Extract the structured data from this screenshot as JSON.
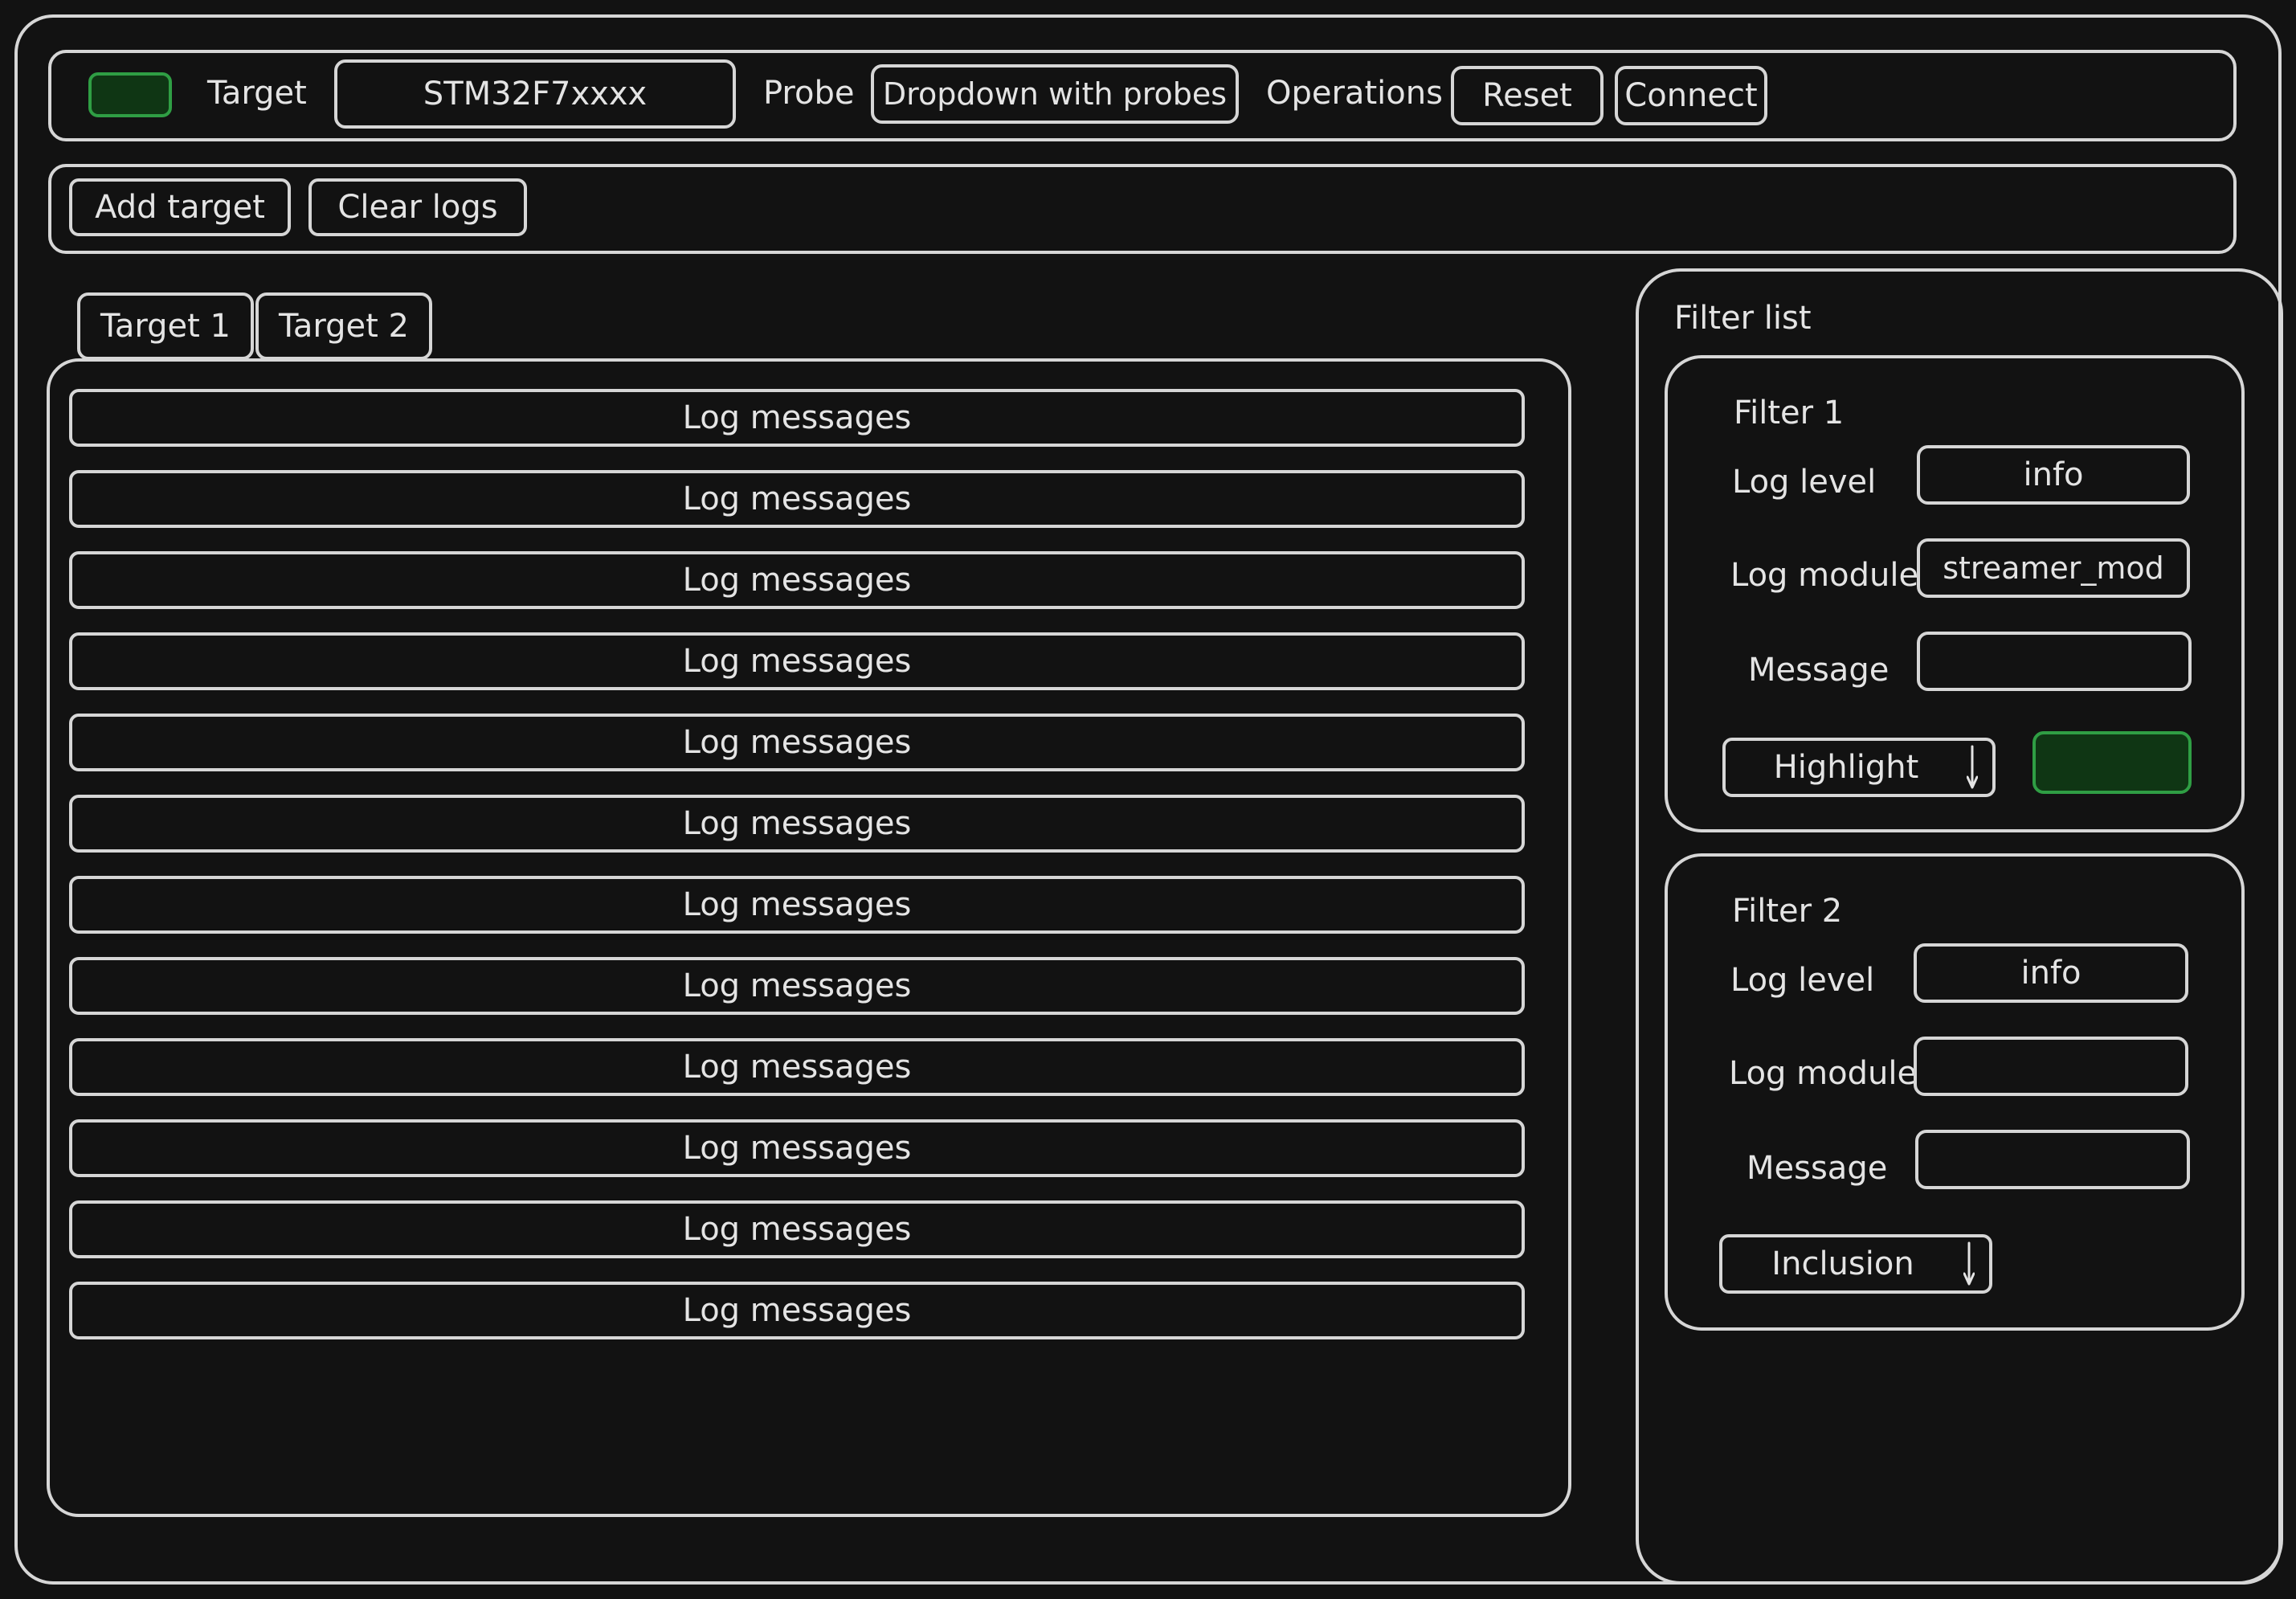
{
  "toolbar": {
    "status_color": "#2f9e44",
    "target_label": "Target",
    "target_value": "STM32F7xxxx",
    "probe_label": "Probe",
    "probe_value": "Dropdown with probes",
    "operations_label": "Operations",
    "reset_label": "Reset",
    "connect_label": "Connect"
  },
  "actions": {
    "add_target_label": "Add target",
    "clear_logs_label": "Clear logs"
  },
  "tabs": [
    {
      "label": "Target 1"
    },
    {
      "label": "Target 2"
    }
  ],
  "logs": [
    "Log messages",
    "Log messages",
    "Log messages",
    "Log messages",
    "Log messages",
    "Log messages",
    "Log messages",
    "Log messages",
    "Log messages",
    "Log messages",
    "Log messages",
    "Log messages"
  ],
  "filter_panel": {
    "title": "Filter list",
    "filters": [
      {
        "title": "Filter 1",
        "log_level_label": "Log level",
        "log_level_value": "info",
        "log_module_label": "Log module",
        "log_module_value": "streamer_mod",
        "message_label": "Message",
        "message_value": "",
        "mode": "Highlight",
        "mode_icon": "arrow-down-icon",
        "highlight_color": "#2f9e44"
      },
      {
        "title": "Filter 2",
        "log_level_label": "Log level",
        "log_level_value": "info",
        "log_module_label": "Log module",
        "log_module_value": "",
        "message_label": "Message",
        "message_value": "",
        "mode": "Inclusion",
        "mode_icon": "arrow-down-icon"
      }
    ]
  }
}
